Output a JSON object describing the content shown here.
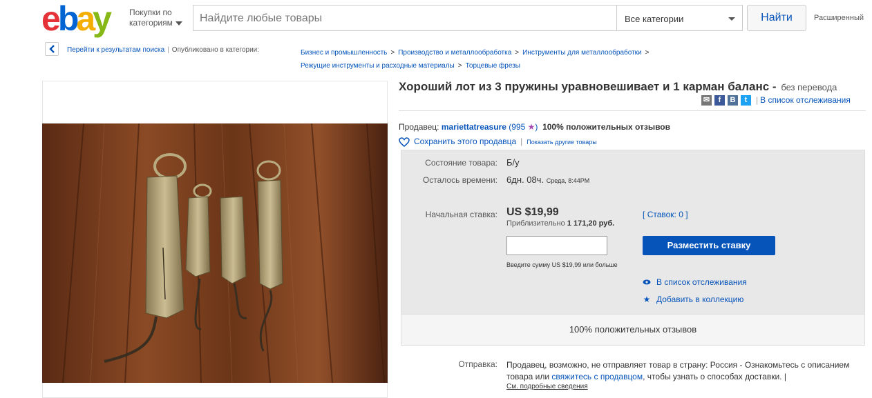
{
  "header": {
    "logo_letters": [
      "e",
      "b",
      "a",
      "y"
    ],
    "logo_colors": [
      "#e53238",
      "#0064d2",
      "#f5af02",
      "#86b817"
    ],
    "shop_by_line1": "Покупки по",
    "shop_by_line2": "категориям",
    "search_placeholder": "Найдите любые товары",
    "category_select": "Все категории",
    "find_button": "Найти",
    "advanced": "Расширенный"
  },
  "breadcrumb": {
    "back_to_results": "Перейти к результатам поиска",
    "published_in": "Опубликовано в категории:",
    "categories": [
      "Бизнес и промышленность",
      "Производство и металлообработка",
      "Инструменты для металлообработки",
      "Режущие инструменты и расходные материалы",
      "Торцевые фрезы"
    ],
    "separator": ">"
  },
  "listing": {
    "title": "Хороший лот из 3 пружины уравновешивает и 1 карман баланс -",
    "no_translation": "без перевода",
    "watchlist_link": "В список отслеживания",
    "seller_label": "Продавец:",
    "seller_name": "mariettatreasure",
    "seller_score": "(995",
    "seller_score_close": ")",
    "positive_feedback": "100% положительных отзывов",
    "save_seller": "Сохранить этого продавца",
    "other_items": "Показать другие товары"
  },
  "details": {
    "condition_label": "Состояние товара:",
    "condition_value": "Б/у",
    "time_left_label": "Осталось времени:",
    "time_left_value": "6дн. 08ч.",
    "time_left_end": "Среда, 8:44PM",
    "starting_bid_label": "Начальная ставка:",
    "price": "US $19,99",
    "approx_label": "Приблизительно",
    "approx_value": "1 171,20 руб.",
    "bids_open": "[",
    "bids_link": "Ставок: 0",
    "bids_close": "]",
    "place_bid_button": "Разместить ставку",
    "bid_hint": "Введите сумму US $19,99 или больше",
    "add_to_watchlist": "В список отслеживания",
    "add_to_collection": "Добавить в коллекцию",
    "footer_feedback": "100% положительных отзывов"
  },
  "shipping": {
    "label": "Отправка:",
    "text_part1": "Продавец, возможно, не отправляет товар в страну: Россия - Ознакомьтесь с описанием товара или",
    "contact_link": "свяжитесь с продавцом",
    "text_part2": ", чтобы узнать о способах доставки. |",
    "details_link": "См. подробные сведения"
  },
  "icons": {
    "email": "email-icon",
    "facebook": "facebook-icon",
    "vk": "vk-icon",
    "twitter": "twitter-icon",
    "heart": "heart-icon",
    "eye": "eye-icon",
    "star": "star-icon",
    "back": "chevron-left-icon"
  }
}
